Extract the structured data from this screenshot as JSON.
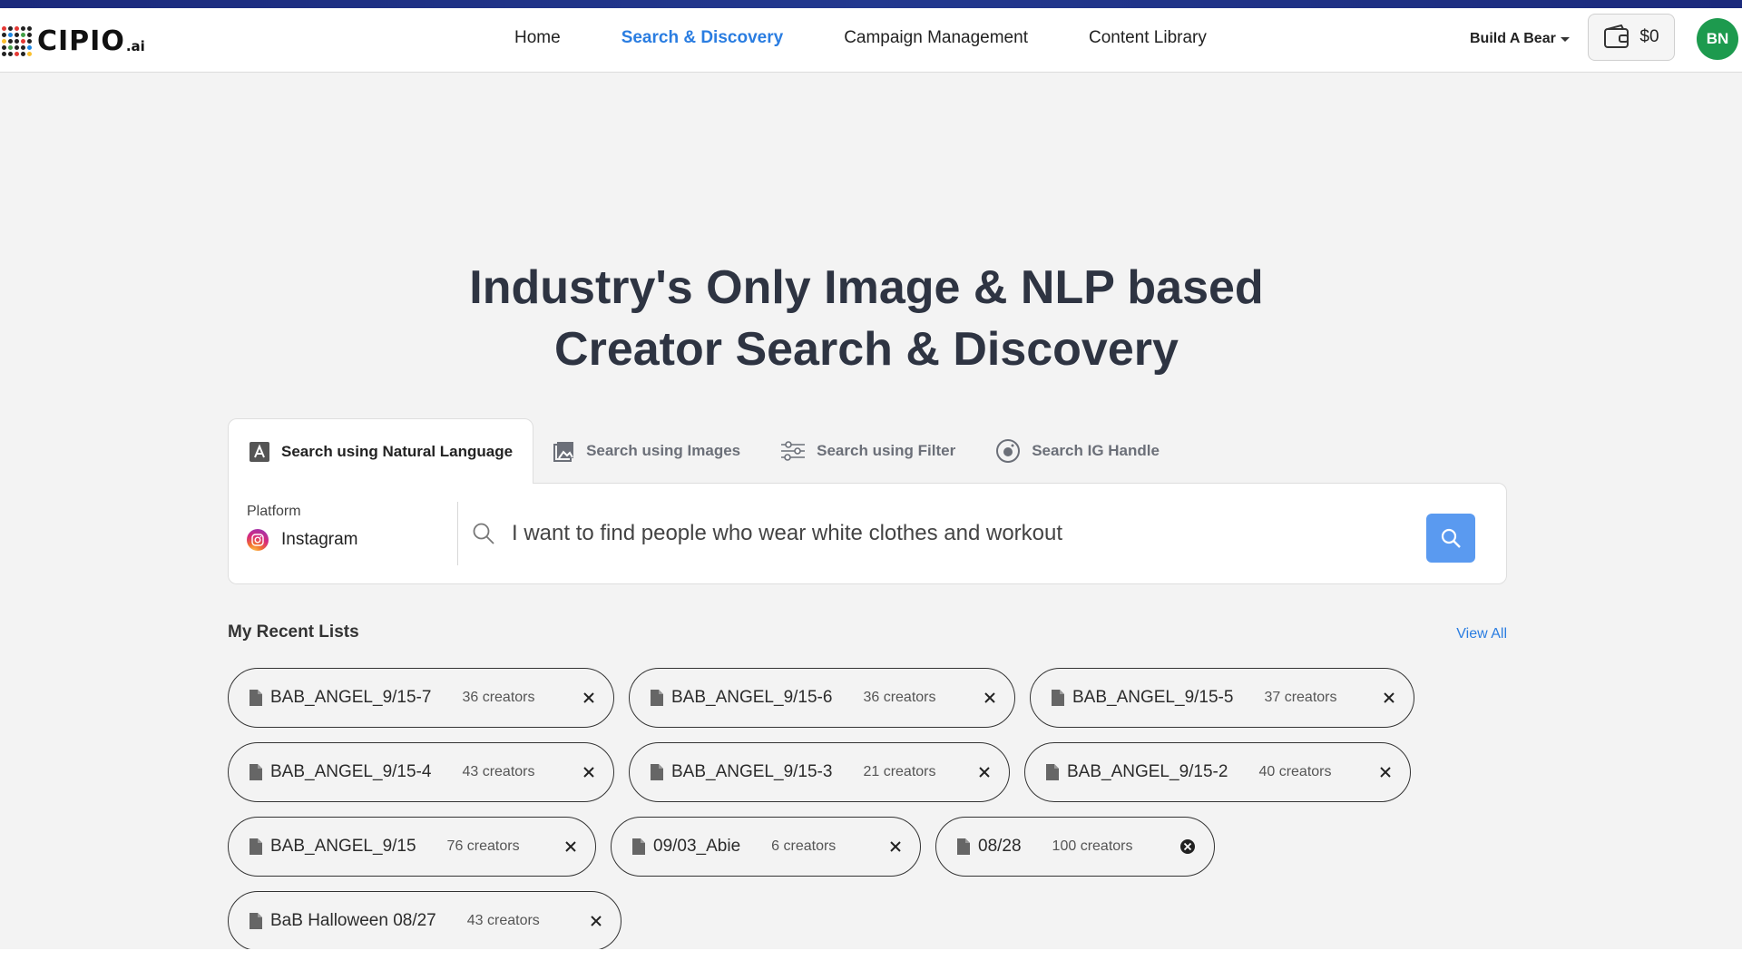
{
  "app": {
    "logo_text": "CIPIO",
    "logo_suffix": ".ai"
  },
  "nav": {
    "items": [
      {
        "label": "Home",
        "active": false
      },
      {
        "label": "Search & Discovery",
        "active": true
      },
      {
        "label": "Campaign Management",
        "active": false
      },
      {
        "label": "Content Library",
        "active": false
      }
    ],
    "brand": "Build A Bear",
    "wallet": "$0",
    "avatar": "BN"
  },
  "hero": {
    "line1": "Industry's Only Image & NLP based",
    "line2": "Creator Search & Discovery"
  },
  "search": {
    "tabs": [
      {
        "label": "Search using Natural Language",
        "icon": "text-a-icon",
        "active": true
      },
      {
        "label": "Search using Images",
        "icon": "image-icon",
        "active": false
      },
      {
        "label": "Search using Filter",
        "icon": "sliders-icon",
        "active": false
      },
      {
        "label": "Search IG Handle",
        "icon": "instagram-outline-icon",
        "active": false
      }
    ],
    "platform_label": "Platform",
    "platform_value": "Instagram",
    "query": "I want to find people who wear white clothes and workout"
  },
  "recent": {
    "title": "My Recent Lists",
    "view_all": "View All",
    "rows": [
      [
        {
          "name": "BAB_ANGEL_9/15-7",
          "count": "36 creators"
        },
        {
          "name": "BAB_ANGEL_9/15-6",
          "count": "36 creators"
        },
        {
          "name": "BAB_ANGEL_9/15-5",
          "count": "37 creators"
        }
      ],
      [
        {
          "name": "BAB_ANGEL_9/15-4",
          "count": "43 creators"
        },
        {
          "name": "BAB_ANGEL_9/15-3",
          "count": "21 creators"
        },
        {
          "name": "BAB_ANGEL_9/15-2",
          "count": "40 creators"
        }
      ],
      [
        {
          "name": "BAB_ANGEL_9/15",
          "count": "76 creators"
        },
        {
          "name": "09/03_Abie",
          "count": "6 creators"
        },
        {
          "name": "08/28",
          "count": "100 creators",
          "close_style": "filled"
        }
      ],
      [
        {
          "name": "BaB Halloween 08/27",
          "count": "43 creators"
        }
      ]
    ]
  },
  "colors": {
    "accent": "#2a7de1",
    "search_button": "#5a9af0",
    "avatar": "#1d9a4e",
    "top_bar": "#1b2a7c"
  }
}
